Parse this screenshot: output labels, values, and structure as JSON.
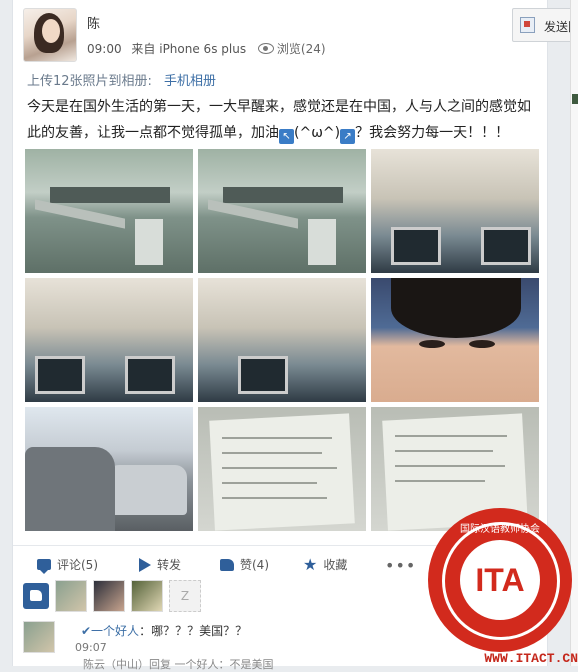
{
  "post": {
    "username": "陈",
    "time": "09:00",
    "source": "来自 iPhone 6s plus",
    "views": "浏览(24)",
    "upload_text": "上传12张照片到相册:",
    "album_link": "手机相册",
    "text_part1": "今天是在国外生活的第一天，一大早醒来，感觉还是在中国，人与人之间的感觉如此的友善，让我一点都不觉得孤单，加油",
    "emoticon": "(^ω^)",
    "text_part2": "？我会努力每一天！！！"
  },
  "share_button": {
    "label": "发送图"
  },
  "actions": {
    "comment": "评论(5)",
    "share": "转发",
    "like": "赞(4)",
    "favorite": "收藏",
    "more": "•••"
  },
  "likers": {
    "placeholder_label": "Z"
  },
  "comments": [
    {
      "name": "✔一个好人",
      "text": "：哪？？？美国？？",
      "time": "09:07"
    },
    {
      "snippet": "陈云（中山）回复 一个好人：不是美国"
    }
  ],
  "watermark": {
    "logo_text": "ITA",
    "ring_top": "国际汉语教师协会",
    "ring_bottom": "International Chinese Language Teacher Association",
    "url": "WWW.ITACT.CN"
  },
  "colors": {
    "link": "#3d6fa6",
    "icon_blue": "#2f5f9a",
    "seal_red": "#d22a1d"
  }
}
